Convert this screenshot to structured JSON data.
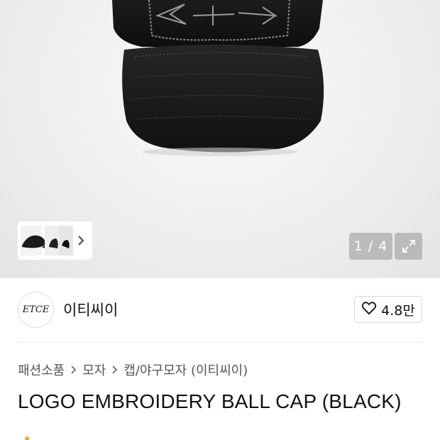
{
  "gallery": {
    "counter": "1 / 4",
    "thumbnail_next": "next-thumbnails"
  },
  "brand": {
    "logo_text": "ETCE",
    "name": "이티씨이",
    "like_count": "4.8만"
  },
  "breadcrumb": {
    "items": [
      "패션소품",
      "모자",
      "캡/야구모자 (이티씨이)"
    ]
  },
  "product": {
    "title": "LOGO EMBROIDERY BALL CAP (BLACK)"
  },
  "colors": {
    "accent_orange": "#f3a53a",
    "overlay_gray": "#969696"
  }
}
